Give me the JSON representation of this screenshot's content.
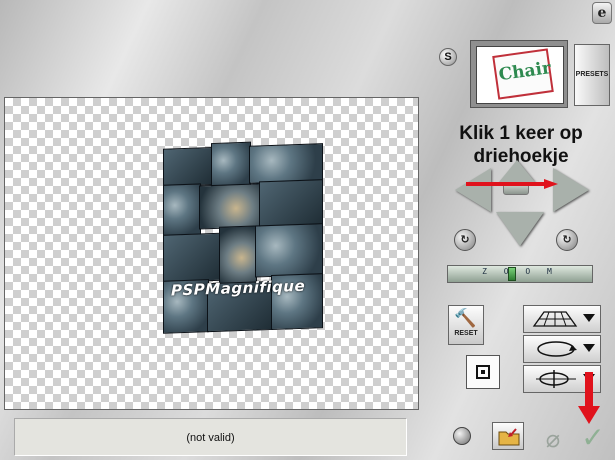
{
  "app": {
    "logo_glyph": "e"
  },
  "canvas": {
    "watermark": "PSPMagnifique"
  },
  "status": {
    "text": "(not valid)"
  },
  "preview": {
    "badge": "S",
    "thumbnail_text": "Chair"
  },
  "preset": {
    "label": "PRESETS"
  },
  "instruction": {
    "line1": "Klik 1 keer op",
    "line2": "driehoekje"
  },
  "slider": {
    "text": "Z O O M",
    "value_fraction": 0.45
  },
  "reset": {
    "label": "RESET"
  },
  "colors": {
    "annotation_red": "#e0121c",
    "pad_fill": "#a9b1ab",
    "slider_thumb": "#2e7d32"
  },
  "icons": {
    "rotate_left": "rotate-left-icon",
    "rotate_right": "rotate-right-icon",
    "hammer": "hammer-icon",
    "grid": "grid-icon",
    "folder": "folder-icon",
    "cancel": "cancel-icon",
    "ok": "check-icon"
  },
  "glyphs": {
    "cancel": "⌀",
    "ok": "✓",
    "rotate": "↻",
    "reset_hammer": "🔨"
  }
}
